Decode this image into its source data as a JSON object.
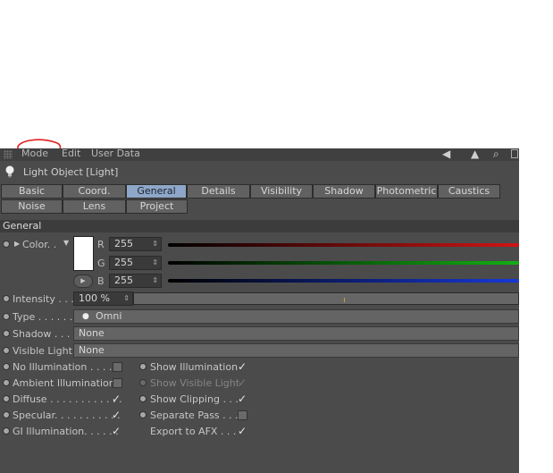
{
  "menu": {
    "items": [
      "Mode",
      "Edit",
      "User Data"
    ]
  },
  "header": {
    "title": "Light Object [Light]"
  },
  "tabs": {
    "row1": [
      "Basic",
      "Coord.",
      "General",
      "Details",
      "Visibility",
      "Shadow",
      "Photometric",
      "Caustics"
    ],
    "row2": [
      "Noise",
      "Lens",
      "Project"
    ],
    "active": "General"
  },
  "section": {
    "title": "General"
  },
  "color": {
    "label": "Color. .",
    "r_label": "R",
    "g_label": "G",
    "b_label": "B",
    "r": "255",
    "g": "255",
    "b": "255",
    "r_track": "#d01414",
    "g_track": "#12b012",
    "b_track": "#1838d8"
  },
  "intensity": {
    "label": "Intensity . . .",
    "value": "100 %",
    "fraction": 1.0
  },
  "type": {
    "label": "Type . . . . . .",
    "value": "Omni"
  },
  "shadow": {
    "label": "Shadow . . .",
    "value": "None"
  },
  "visible_light": {
    "label": "Visible Light",
    "value": "None"
  },
  "options_left": [
    {
      "label": "No Illumination . . . . .",
      "checked": false
    },
    {
      "label": "Ambient Illumination",
      "checked": false
    },
    {
      "label": "Diffuse . . . . . . . . . . . .",
      "checked": true
    },
    {
      "label": "Specular. . . . . . . . . . .",
      "checked": true
    },
    {
      "label": "GI Illumination. . . . . .",
      "checked": true
    }
  ],
  "options_right": [
    {
      "label": "Show Illumination",
      "checked": true,
      "enabled": true
    },
    {
      "label": "Show Visible Light",
      "checked": true,
      "enabled": false
    },
    {
      "label": "Show Clipping . . .",
      "checked": true,
      "enabled": true
    },
    {
      "label": "Separate Pass . . .",
      "checked": false,
      "enabled": true
    },
    {
      "label": "Export to AFX . . .",
      "checked": true,
      "enabled": true
    }
  ],
  "colors": {
    "panel": "#4b4b4b",
    "active_tab": "#8ea7c8",
    "annotation": "#e02020"
  },
  "glyphs": {
    "check": "✓",
    "spin": "⇕"
  }
}
